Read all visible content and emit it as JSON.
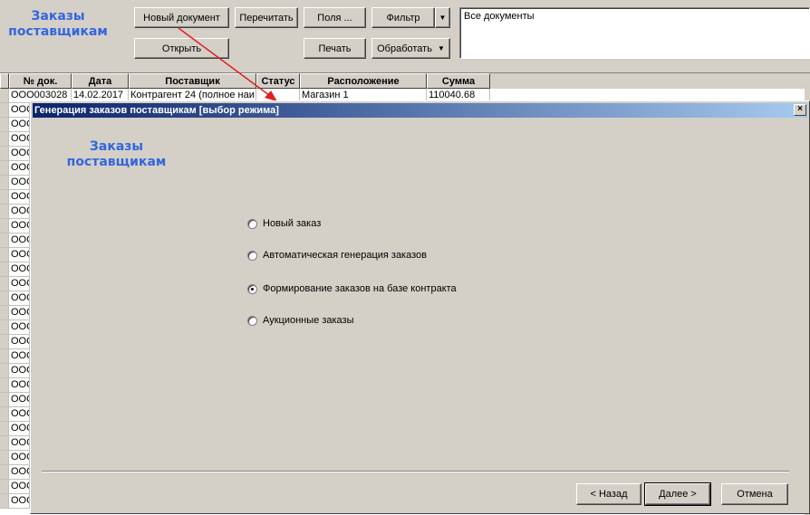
{
  "main": {
    "title": "Заказы поставщикам",
    "toolbar": {
      "new_doc": "Новый документ",
      "recalc": "Перечитать",
      "fields": "Поля ...",
      "filter": "Фильтр",
      "open": "Открыть",
      "print": "Печать",
      "process": "Обработать"
    },
    "filter_text": "Все документы",
    "table": {
      "headers": [
        "№ док.",
        "Дата",
        "Поставщик",
        "Статус",
        "Расположение",
        "Сумма"
      ],
      "first_row": [
        "OOO003028",
        "14.02.2017",
        "Контрагент 24 (полное наи",
        "",
        "Магазин 1",
        "110040.68"
      ],
      "row_prefix": "OOC"
    }
  },
  "dialog": {
    "caption": "Генерация заказов поставщикам [выбор режима]",
    "close": "×",
    "logo": "Заказы поставщикам",
    "options": [
      {
        "label": "Новый заказ",
        "checked": false
      },
      {
        "label": "Автоматическая генерация заказов",
        "checked": false
      },
      {
        "label": "Формирование заказов на базе контракта",
        "checked": true
      },
      {
        "label": "Аукционные заказы",
        "checked": false
      }
    ],
    "back": "< Назад",
    "next": "Далее >",
    "cancel": "Отмена"
  },
  "colors": {
    "accent": "#3366dd",
    "caption_start": "#0a246a",
    "caption_end": "#a6caf0",
    "arrow": "#e02020"
  }
}
